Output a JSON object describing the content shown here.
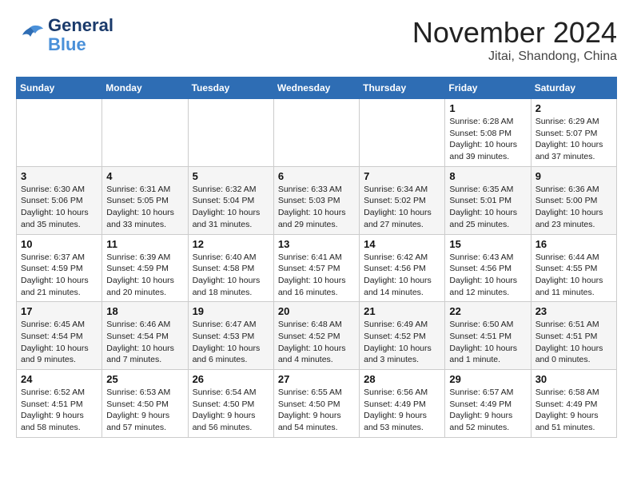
{
  "header": {
    "logo_line1": "General",
    "logo_line2": "Blue",
    "month_title": "November 2024",
    "location": "Jitai, Shandong, China"
  },
  "weekdays": [
    "Sunday",
    "Monday",
    "Tuesday",
    "Wednesday",
    "Thursday",
    "Friday",
    "Saturday"
  ],
  "weeks": [
    [
      {
        "day": "",
        "info": ""
      },
      {
        "day": "",
        "info": ""
      },
      {
        "day": "",
        "info": ""
      },
      {
        "day": "",
        "info": ""
      },
      {
        "day": "",
        "info": ""
      },
      {
        "day": "1",
        "info": "Sunrise: 6:28 AM\nSunset: 5:08 PM\nDaylight: 10 hours and 39 minutes."
      },
      {
        "day": "2",
        "info": "Sunrise: 6:29 AM\nSunset: 5:07 PM\nDaylight: 10 hours and 37 minutes."
      }
    ],
    [
      {
        "day": "3",
        "info": "Sunrise: 6:30 AM\nSunset: 5:06 PM\nDaylight: 10 hours and 35 minutes."
      },
      {
        "day": "4",
        "info": "Sunrise: 6:31 AM\nSunset: 5:05 PM\nDaylight: 10 hours and 33 minutes."
      },
      {
        "day": "5",
        "info": "Sunrise: 6:32 AM\nSunset: 5:04 PM\nDaylight: 10 hours and 31 minutes."
      },
      {
        "day": "6",
        "info": "Sunrise: 6:33 AM\nSunset: 5:03 PM\nDaylight: 10 hours and 29 minutes."
      },
      {
        "day": "7",
        "info": "Sunrise: 6:34 AM\nSunset: 5:02 PM\nDaylight: 10 hours and 27 minutes."
      },
      {
        "day": "8",
        "info": "Sunrise: 6:35 AM\nSunset: 5:01 PM\nDaylight: 10 hours and 25 minutes."
      },
      {
        "day": "9",
        "info": "Sunrise: 6:36 AM\nSunset: 5:00 PM\nDaylight: 10 hours and 23 minutes."
      }
    ],
    [
      {
        "day": "10",
        "info": "Sunrise: 6:37 AM\nSunset: 4:59 PM\nDaylight: 10 hours and 21 minutes."
      },
      {
        "day": "11",
        "info": "Sunrise: 6:39 AM\nSunset: 4:59 PM\nDaylight: 10 hours and 20 minutes."
      },
      {
        "day": "12",
        "info": "Sunrise: 6:40 AM\nSunset: 4:58 PM\nDaylight: 10 hours and 18 minutes."
      },
      {
        "day": "13",
        "info": "Sunrise: 6:41 AM\nSunset: 4:57 PM\nDaylight: 10 hours and 16 minutes."
      },
      {
        "day": "14",
        "info": "Sunrise: 6:42 AM\nSunset: 4:56 PM\nDaylight: 10 hours and 14 minutes."
      },
      {
        "day": "15",
        "info": "Sunrise: 6:43 AM\nSunset: 4:56 PM\nDaylight: 10 hours and 12 minutes."
      },
      {
        "day": "16",
        "info": "Sunrise: 6:44 AM\nSunset: 4:55 PM\nDaylight: 10 hours and 11 minutes."
      }
    ],
    [
      {
        "day": "17",
        "info": "Sunrise: 6:45 AM\nSunset: 4:54 PM\nDaylight: 10 hours and 9 minutes."
      },
      {
        "day": "18",
        "info": "Sunrise: 6:46 AM\nSunset: 4:54 PM\nDaylight: 10 hours and 7 minutes."
      },
      {
        "day": "19",
        "info": "Sunrise: 6:47 AM\nSunset: 4:53 PM\nDaylight: 10 hours and 6 minutes."
      },
      {
        "day": "20",
        "info": "Sunrise: 6:48 AM\nSunset: 4:52 PM\nDaylight: 10 hours and 4 minutes."
      },
      {
        "day": "21",
        "info": "Sunrise: 6:49 AM\nSunset: 4:52 PM\nDaylight: 10 hours and 3 minutes."
      },
      {
        "day": "22",
        "info": "Sunrise: 6:50 AM\nSunset: 4:51 PM\nDaylight: 10 hours and 1 minute."
      },
      {
        "day": "23",
        "info": "Sunrise: 6:51 AM\nSunset: 4:51 PM\nDaylight: 10 hours and 0 minutes."
      }
    ],
    [
      {
        "day": "24",
        "info": "Sunrise: 6:52 AM\nSunset: 4:51 PM\nDaylight: 9 hours and 58 minutes."
      },
      {
        "day": "25",
        "info": "Sunrise: 6:53 AM\nSunset: 4:50 PM\nDaylight: 9 hours and 57 minutes."
      },
      {
        "day": "26",
        "info": "Sunrise: 6:54 AM\nSunset: 4:50 PM\nDaylight: 9 hours and 56 minutes."
      },
      {
        "day": "27",
        "info": "Sunrise: 6:55 AM\nSunset: 4:50 PM\nDaylight: 9 hours and 54 minutes."
      },
      {
        "day": "28",
        "info": "Sunrise: 6:56 AM\nSunset: 4:49 PM\nDaylight: 9 hours and 53 minutes."
      },
      {
        "day": "29",
        "info": "Sunrise: 6:57 AM\nSunset: 4:49 PM\nDaylight: 9 hours and 52 minutes."
      },
      {
        "day": "30",
        "info": "Sunrise: 6:58 AM\nSunset: 4:49 PM\nDaylight: 9 hours and 51 minutes."
      }
    ]
  ]
}
